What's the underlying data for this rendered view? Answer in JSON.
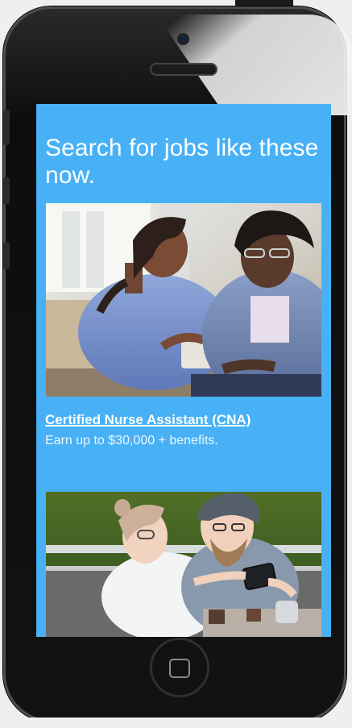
{
  "screen": {
    "headline": "Search for jobs like these now.",
    "job_card_1": {
      "title": "Certified Nurse Assistant (CNA)",
      "subtitle": "Earn up to $30,000 + benefits."
    }
  },
  "colors": {
    "screen_background": "#48b1f6",
    "text": "#ffffff",
    "phone_body": "#111111"
  },
  "icons": {
    "home": "home-icon",
    "camera": "camera-icon",
    "speaker": "speaker-icon"
  }
}
